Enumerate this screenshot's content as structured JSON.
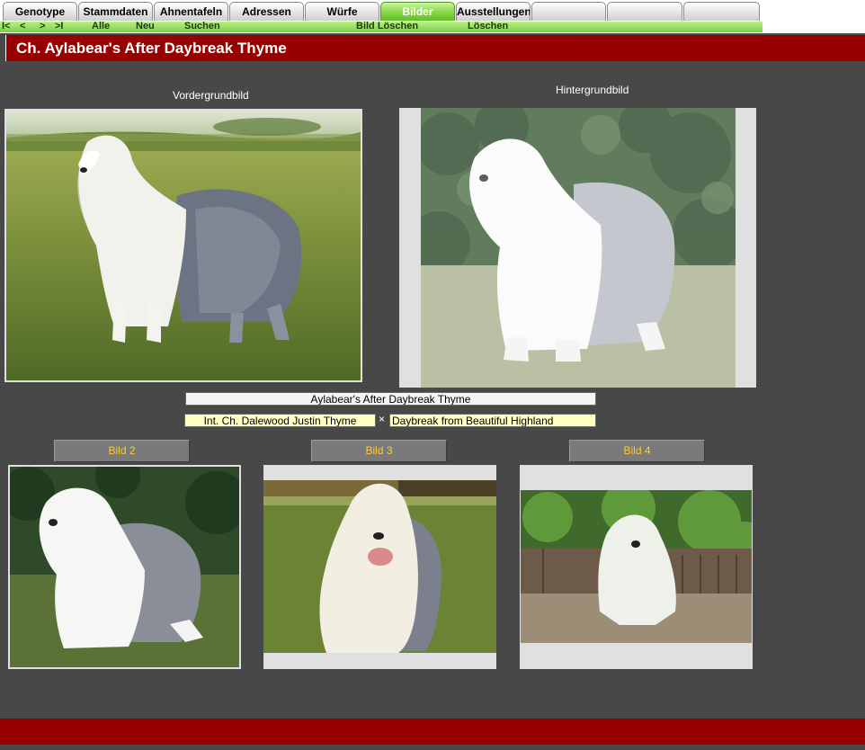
{
  "tabs": [
    {
      "label": "Genotype",
      "active": false
    },
    {
      "label": "Stammdaten",
      "active": false
    },
    {
      "label": "Ahnentafeln",
      "active": false
    },
    {
      "label": "Adressen",
      "active": false
    },
    {
      "label": "Würfe",
      "active": false
    },
    {
      "label": "Bilder",
      "active": true
    },
    {
      "label": "Ausstellungen",
      "active": false
    },
    {
      "label": "",
      "active": false
    },
    {
      "label": "",
      "active": false
    },
    {
      "label": "",
      "active": false
    }
  ],
  "nav": {
    "first": "I<",
    "prev": "<",
    "next": ">",
    "last": ">I",
    "alle": "Alle",
    "neu": "Neu",
    "suchen": "Suchen",
    "bild_loeschen": "Bild Löschen",
    "loeschen": "Löschen"
  },
  "record": {
    "title": "Ch. Aylabear's After Daybreak Thyme",
    "dog_name": "Aylabear's After Daybreak Thyme",
    "sire": "Int. Ch. Dalewood Justin Thyme",
    "dam": "Daybreak from Beautiful Highland",
    "cross_symbol": "×"
  },
  "images": {
    "foreground_label": "Vordergrundbild",
    "background_label": "Hintergrundbild",
    "bild2_label": "Bild 2",
    "bild3_label": "Bild 3",
    "bild4_label": "Bild 4"
  },
  "colors": {
    "content_bg": "#484848",
    "title_bar": "#990000",
    "tab_active": "#7ccf3d",
    "button_text": "#ffcc33"
  }
}
